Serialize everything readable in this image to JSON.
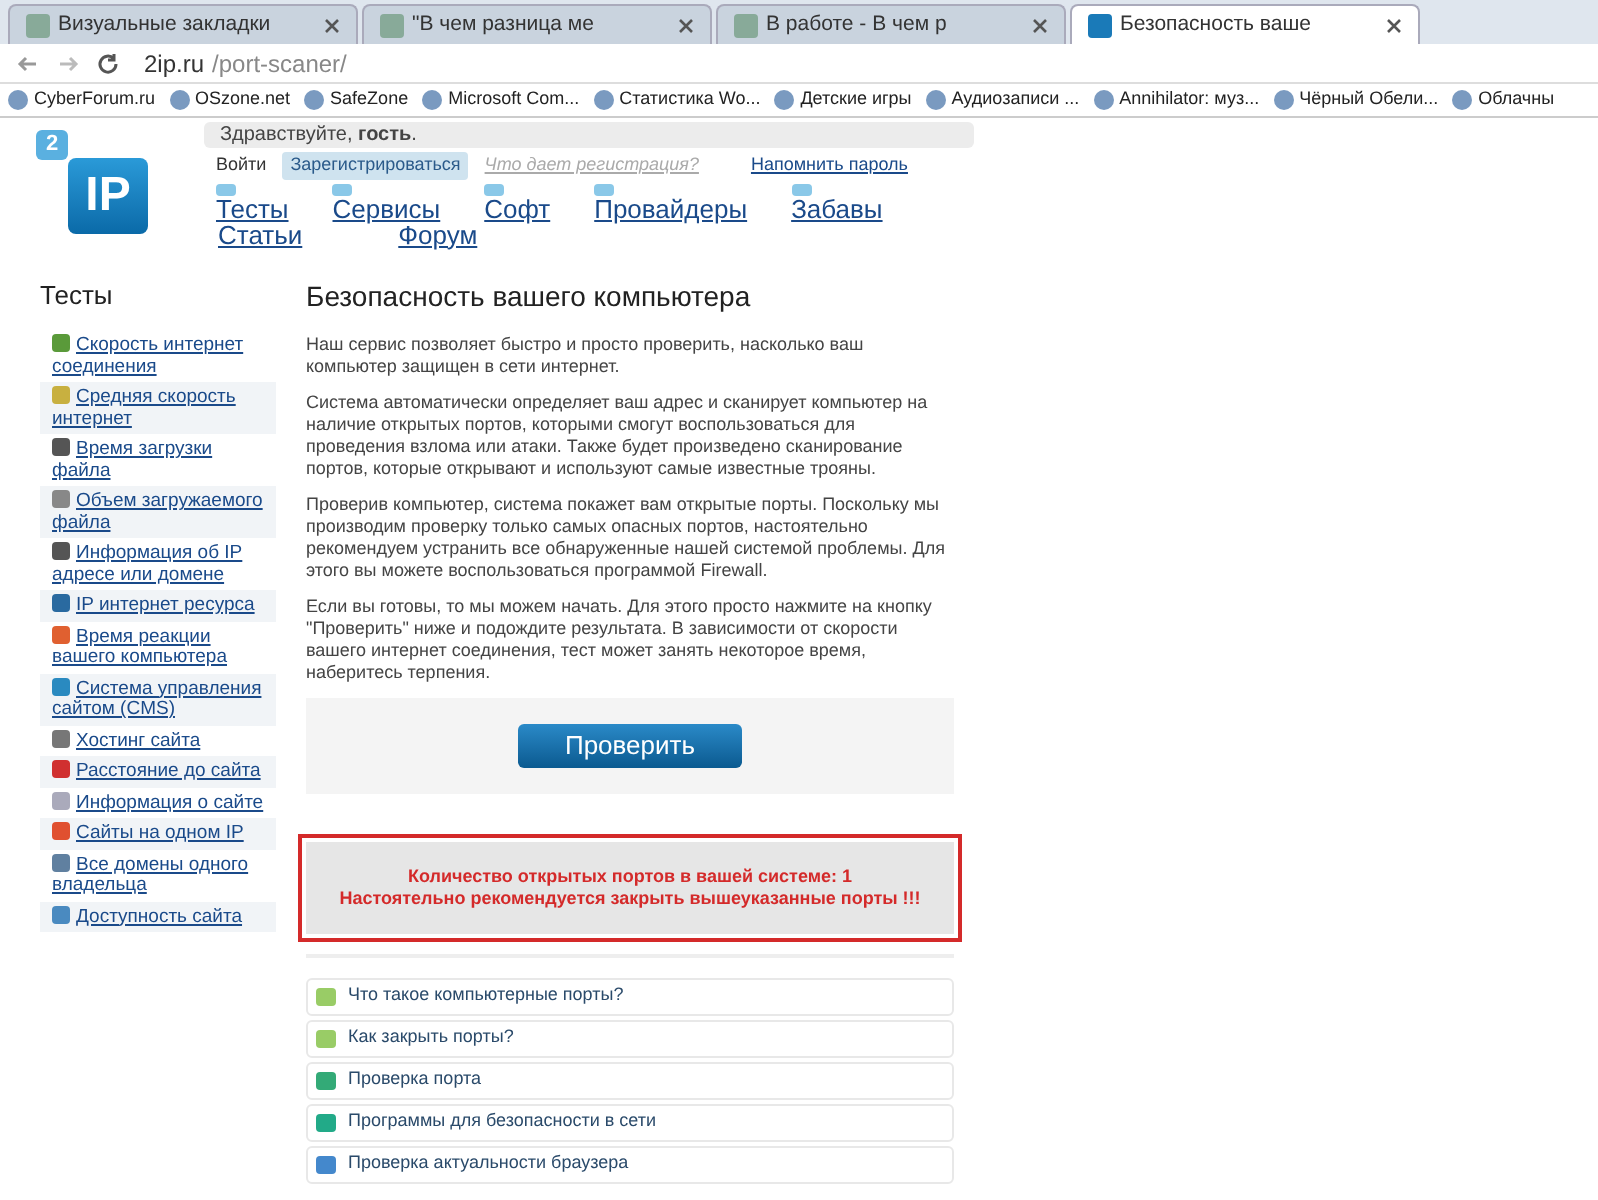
{
  "browser": {
    "tabs": [
      {
        "label": "Визуальные закладки",
        "selected": false
      },
      {
        "label": "\"В чем разница ме",
        "selected": false
      },
      {
        "label": "В работе - В чем р",
        "selected": false
      },
      {
        "label": "Безопасность ваше",
        "selected": true
      }
    ],
    "url_host": "2ip.ru",
    "url_path": "/port-scaner/",
    "bookmarks": [
      "CyberForum.ru",
      "OSzone.net",
      "SafeZone",
      "Microsoft Com...",
      "Статистика Wo...",
      "Детские игры",
      "Аудиозаписи ...",
      "Annihilator: муз...",
      "Чёрный Обели...",
      "Облачны"
    ]
  },
  "header": {
    "greeting": "Здравствуйте, **гость**.",
    "login": "Войти",
    "register": "Зарегистрироваться",
    "why_register": "Что дает регистрация?",
    "remind_password": "Напомнить пароль",
    "logo_badge": "2",
    "logo_text": "IP",
    "nav_row_1": [
      "Тесты",
      "Сервисы",
      "Софт",
      "Провайдеры",
      "Забавы"
    ],
    "nav_row_2": [
      "Статьи",
      "Форум"
    ]
  },
  "sidebar": {
    "title": "Тесты",
    "items": [
      "Скорость интернет соединения",
      "Средняя скорость интернет",
      "Время загрузки файла",
      "Объем загружаемого файла",
      "Информация об IP адресе или домене",
      "IP интернет ресурса",
      "Время реакции вашего компьютера",
      "Система управления сайтом (CMS)",
      "Хостинг сайта",
      "Расстояние до сайта",
      "Информация о сайте",
      "Сайты на одном IP",
      "Все домены одного владельца",
      "Доступность сайта"
    ]
  },
  "content": {
    "title": "Безопасность вашего компьютера",
    "paragraphs": [
      "Наш сервис позволяет быстро и просто проверить, насколько ваш компьютер защищен в сети интернет.",
      "Система автоматически определяет ваш адрес и сканирует компьютер на наличие открытых портов, которыми смогут воспользоваться для проведения взлома или атаки. Также будет произведено сканирование портов, которые открывают и используют самые известные трояны.",
      "Проверив компьютер, система покажет вам открытые порты. Поскольку мы производим проверку только самых опасных портов, настоятельно рекомендуем устранить все обнаруженные нашей системой проблемы. Для этого вы можете воспользоваться программой Firewall.",
      "Если вы готовы, то мы можем начать. Для этого просто нажмите на кнопку \"Проверить\" ниже и подождите результата. В зависимости от скорости вашего интернет соединения, тест может занять некоторое время, наберитесь терпения."
    ],
    "check_button": "Проверить",
    "result_lines": [
      "Количество открытых портов в вашей системе: 1",
      "Настоятельно рекомендуется закрыть вышеуказанные порты !!!"
    ],
    "links": [
      "Что такое компьютерные порты?",
      "Как закрыть порты?",
      "Проверка порта",
      "Программы для безопасности в сети",
      "Проверка актуальности браузера"
    ]
  }
}
